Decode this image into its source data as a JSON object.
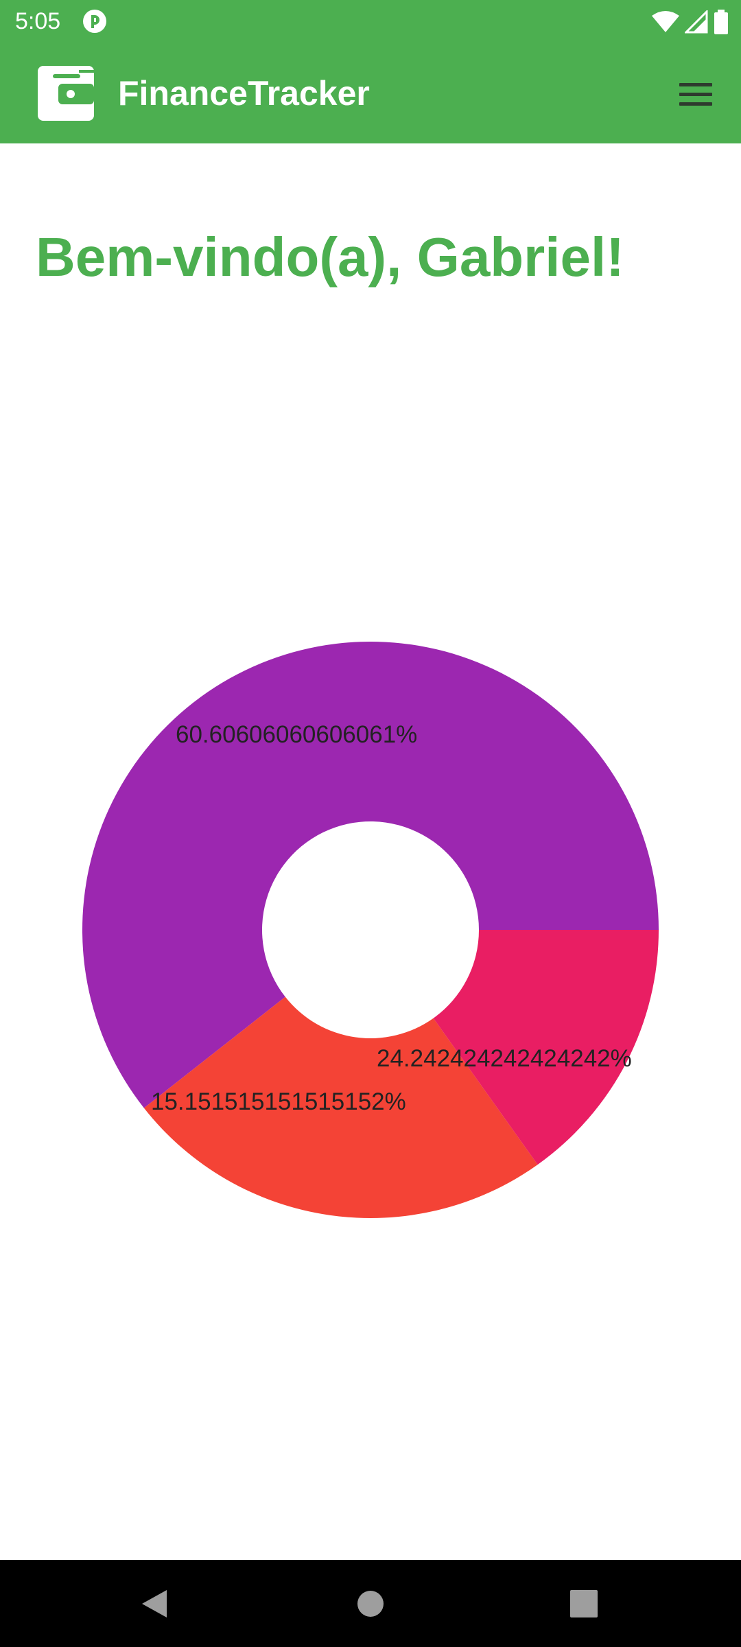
{
  "status_bar": {
    "time": "5:05",
    "icons": [
      "app-notification-icon",
      "wifi-icon",
      "cellular-signal-icon",
      "battery-icon"
    ]
  },
  "app_bar": {
    "title": "FinanceTracker",
    "logo_icon": "wallet-icon",
    "menu_icon": "hamburger-menu-icon"
  },
  "main": {
    "welcome_text": "Bem-vindo(a), Gabriel!"
  },
  "colors": {
    "primary": "#4caf50",
    "slice_purple": "#9c27b0",
    "slice_red": "#f44336",
    "slice_pink": "#e91e63"
  },
  "chart_data": {
    "type": "pie",
    "variant": "donut",
    "slices": [
      {
        "label": "60.60606060606061%",
        "value": 60.60606060606061,
        "color": "#9c27b0"
      },
      {
        "label": "24.242424242424242%",
        "value": 24.242424242424242,
        "color": "#f44336"
      },
      {
        "label": "15.151515151515152%",
        "value": 15.151515151515152,
        "color": "#e91e63"
      }
    ],
    "legend": "none"
  },
  "nav_bar": {
    "buttons": [
      "back-icon",
      "home-icon",
      "recents-icon"
    ]
  }
}
